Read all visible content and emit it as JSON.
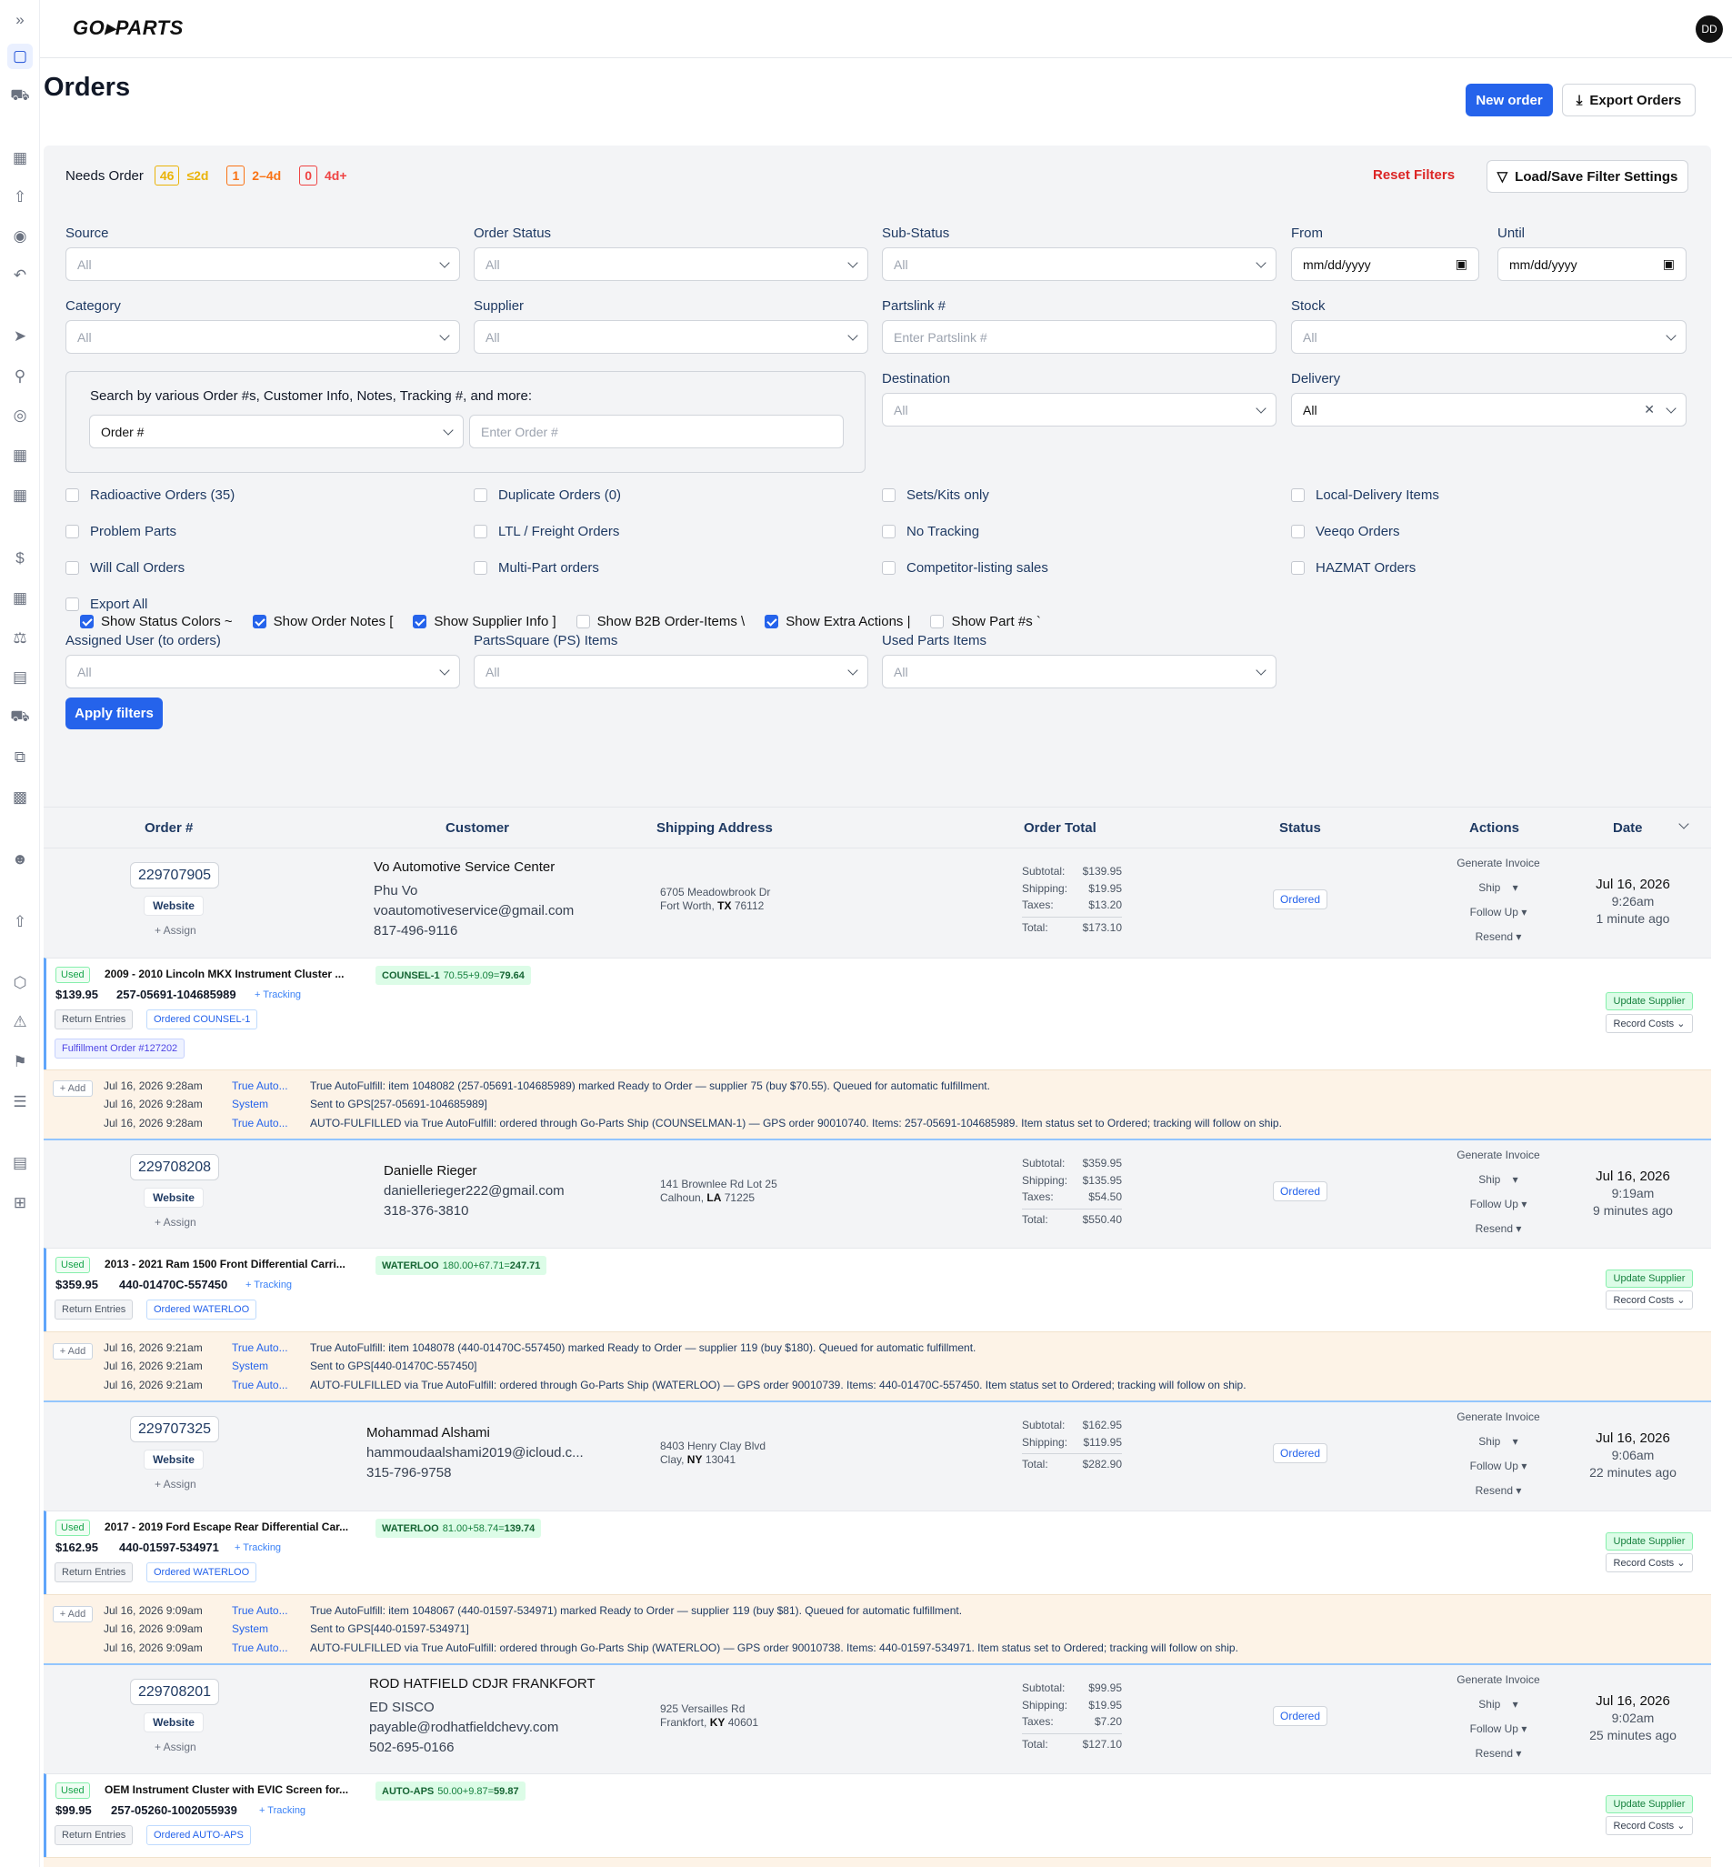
{
  "app": {
    "logo": "GO▸PARTS",
    "avatar": "DD"
  },
  "page": {
    "title": "Orders",
    "new_order": "New order",
    "export": "Export Orders"
  },
  "filters": {
    "needs_order_label": "Needs Order",
    "badges": [
      {
        "count": "46",
        "label": "≤2d",
        "color": "#eab308"
      },
      {
        "count": "1",
        "label": "2–4d",
        "color": "#f97316"
      },
      {
        "count": "0",
        "label": "4d+",
        "color": "#ef4444"
      }
    ],
    "reset": "Reset Filters",
    "load_save": "Load/Save Filter Settings",
    "source": {
      "label": "Source",
      "value": "All"
    },
    "order_status": {
      "label": "Order Status",
      "value": "All"
    },
    "sub_status": {
      "label": "Sub-Status",
      "value": "All"
    },
    "from": {
      "label": "From",
      "value": "mm/dd/yyyy"
    },
    "until": {
      "label": "Until",
      "value": "mm/dd/yyyy"
    },
    "category": {
      "label": "Category",
      "value": "All"
    },
    "supplier": {
      "label": "Supplier",
      "value": "All"
    },
    "partslink": {
      "label": "Partslink #",
      "placeholder": "Enter Partslink #"
    },
    "stock": {
      "label": "Stock",
      "value": "All"
    },
    "search_hint": "Search by various Order #s, Customer Info, Notes, Tracking #, and more:",
    "search_type": "Order #",
    "search_placeholder": "Enter Order #",
    "destination": {
      "label": "Destination",
      "value": "All"
    },
    "delivery": {
      "label": "Delivery",
      "value": "All"
    },
    "checkboxes": [
      [
        "Radioactive Orders (35)",
        "Duplicate Orders (0)",
        "Sets/Kits only",
        "Local-Delivery Items"
      ],
      [
        "Problem Parts",
        "LTL / Freight Orders",
        "No Tracking",
        "Veeqo Orders"
      ],
      [
        "Will Call Orders",
        "Multi-Part orders",
        "Competitor-listing sales",
        "HAZMAT Orders"
      ],
      [
        "Export All"
      ]
    ],
    "assigned_user": {
      "label": "Assigned User (to orders)",
      "value": "All"
    },
    "partssquare": {
      "label": "PartsSquare (PS) Items",
      "value": "All"
    },
    "used_parts": {
      "label": "Used Parts Items",
      "value": "All"
    },
    "apply": "Apply filters"
  },
  "show_toggles": [
    {
      "label": "Show Status Colors ~",
      "checked": true
    },
    {
      "label": "Show Order Notes [",
      "checked": true
    },
    {
      "label": "Show Supplier Info ]",
      "checked": true
    },
    {
      "label": "Show B2B Order-Items \\",
      "checked": false
    },
    {
      "label": "Show Extra Actions |",
      "checked": true
    },
    {
      "label": "Show Part #s `",
      "checked": false
    }
  ],
  "table": {
    "headers": [
      "Order #",
      "Customer",
      "Shipping Address",
      "Order Total",
      "Status",
      "Actions",
      "Date"
    ]
  },
  "common": {
    "website": "Website",
    "assign": "+ Assign",
    "status": "Ordered",
    "actions": [
      "Generate Invoice",
      "Ship",
      "Follow Up",
      "Resend"
    ],
    "used": "Used",
    "tracking": "+ Tracking",
    "return_entries": "Return Entries",
    "update_supplier": "Update Supplier",
    "record_costs": "Record Costs ⌄",
    "add": "+ Add"
  },
  "orders": [
    {
      "number": "229707905",
      "customer": [
        "Vo Automotive Service Center",
        "Phu Vo",
        "voautomotiveservice@gmail.com",
        "817-496-9116"
      ],
      "address1": "6705 Meadowbrook Dr",
      "city": "Fort Worth,",
      "state": "TX",
      "zip": "76112",
      "totals": [
        [
          "Subtotal:",
          "$139.95"
        ],
        [
          "Shipping:",
          "$19.95"
        ],
        [
          "Taxes:",
          "$13.20"
        ],
        [
          "Total:",
          "$173.10"
        ]
      ],
      "date": "Jul 16, 2026",
      "time": "9:26am",
      "ago": "1 minute ago",
      "item": {
        "name": "2009 - 2010 Lincoln MKX Instrument Cluster ...",
        "price": "$139.95",
        "part": "257-05691-104685989",
        "supplier": "COUNSEL-1",
        "calc": "70.55+9.09=",
        "calc_total": "79.64",
        "ordered": "Ordered COUNSEL-1",
        "fulfillment": "Fulfillment Order #127202"
      },
      "notes": [
        [
          "Jul 16, 2026  9:28am",
          "True Auto...",
          "True AutoFulfill: item 1048082 (257-05691-104685989) marked Ready to Order — supplier 75 (buy $70.55). Queued for automatic fulfillment."
        ],
        [
          "Jul 16, 2026  9:28am",
          "System",
          "Sent to GPS[257-05691-104685989]"
        ],
        [
          "Jul 16, 2026  9:28am",
          "True Auto...",
          "AUTO-FULFILLED via True AutoFulfill: ordered through Go-Parts Ship (COUNSELMAN-1) — GPS order 90010740. Items: 257-05691-104685989. Item status set to Ordered; tracking will follow on ship."
        ]
      ]
    },
    {
      "number": "229708208",
      "customer": [
        "Danielle Rieger",
        "daniellerieger222@gmail.com",
        "318-376-3810"
      ],
      "address1": "141 Brownlee Rd Lot 25",
      "city": "Calhoun,",
      "state": "LA",
      "zip": "71225",
      "totals": [
        [
          "Subtotal:",
          "$359.95"
        ],
        [
          "Shipping:",
          "$135.95"
        ],
        [
          "Taxes:",
          "$54.50"
        ],
        [
          "Total:",
          "$550.40"
        ]
      ],
      "date": "Jul 16, 2026",
      "time": "9:19am",
      "ago": "9 minutes ago",
      "item": {
        "name": "2013 - 2021 Ram 1500 Front Differential Carri...",
        "price": "$359.95",
        "part": "440-01470C-557450",
        "supplier": "WATERLOO",
        "calc": "180.00+67.71=",
        "calc_total": "247.71",
        "ordered": "Ordered WATERLOO"
      },
      "notes": [
        [
          "Jul 16, 2026  9:21am",
          "True Auto...",
          "True AutoFulfill: item 1048078 (440-01470C-557450) marked Ready to Order — supplier 119 (buy $180). Queued for automatic fulfillment."
        ],
        [
          "Jul 16, 2026  9:21am",
          "System",
          "Sent to GPS[440-01470C-557450]"
        ],
        [
          "Jul 16, 2026  9:21am",
          "True Auto...",
          "AUTO-FULFILLED via True AutoFulfill: ordered through Go-Parts Ship (WATERLOO) — GPS order 90010739. Items: 440-01470C-557450. Item status set to Ordered; tracking will follow on ship."
        ]
      ]
    },
    {
      "number": "229707325",
      "customer": [
        "Mohammad Alshami",
        "hammoudaalshami2019@icloud.c...",
        "315-796-9758"
      ],
      "address1": "8403 Henry Clay Blvd",
      "city": "Clay,",
      "state": "NY",
      "zip": "13041",
      "totals": [
        [
          "Subtotal:",
          "$162.95"
        ],
        [
          "Shipping:",
          "$119.95"
        ],
        [
          "Total:",
          "$282.90"
        ]
      ],
      "date": "Jul 16, 2026",
      "time": "9:06am",
      "ago": "22 minutes ago",
      "item": {
        "name": "2017 - 2019 Ford Escape Rear Differential Car...",
        "price": "$162.95",
        "part": "440-01597-534971",
        "supplier": "WATERLOO",
        "calc": "81.00+58.74=",
        "calc_total": "139.74",
        "ordered": "Ordered WATERLOO"
      },
      "notes": [
        [
          "Jul 16, 2026  9:09am",
          "True Auto...",
          "True AutoFulfill: item 1048067 (440-01597-534971) marked Ready to Order — supplier 119 (buy $81). Queued for automatic fulfillment."
        ],
        [
          "Jul 16, 2026  9:09am",
          "System",
          "Sent to GPS[440-01597-534971]"
        ],
        [
          "Jul 16, 2026  9:09am",
          "True Auto...",
          "AUTO-FULFILLED via True AutoFulfill: ordered through Go-Parts Ship (WATERLOO) — GPS order 90010738. Items: 440-01597-534971. Item status set to Ordered; tracking will follow on ship."
        ]
      ]
    },
    {
      "number": "229708201",
      "customer": [
        "ROD HATFIELD CDJR FRANKFORT",
        "ED SISCO",
        "payable@rodhatfieldchevy.com",
        "502-695-0166"
      ],
      "address1": "925 Versailles Rd",
      "city": "Frankfort,",
      "state": "KY",
      "zip": "40601",
      "totals": [
        [
          "Subtotal:",
          "$99.95"
        ],
        [
          "Shipping:",
          "$19.95"
        ],
        [
          "Taxes:",
          "$7.20"
        ],
        [
          "Total:",
          "$127.10"
        ]
      ],
      "date": "Jul 16, 2026",
      "time": "9:02am",
      "ago": "25 minutes ago",
      "item": {
        "name": "OEM Instrument Cluster with EVIC Screen for...",
        "price": "$99.95",
        "part": "257-05260-1002055939",
        "supplier": "AUTO-APS",
        "calc": "50.00+9.87=",
        "calc_total": "59.87",
        "ordered": "Ordered AUTO-APS"
      },
      "notes": []
    }
  ]
}
